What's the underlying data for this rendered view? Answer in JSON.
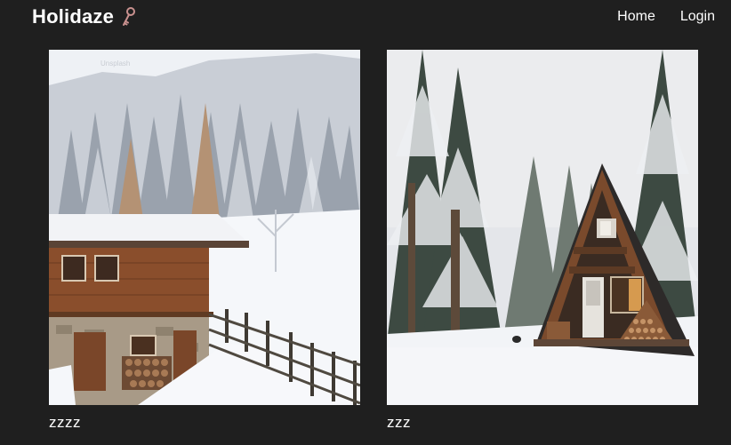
{
  "navbar": {
    "brand_text": "Holidaze",
    "brand_icon": "key-icon",
    "links": [
      {
        "label": "Home"
      },
      {
        "label": "Login"
      }
    ]
  },
  "venues": [
    {
      "title": "zzzz",
      "image": "snowy-wooden-chalet-photo",
      "watermark": "Unsplash"
    },
    {
      "title": "zzz",
      "image": "snowy-a-frame-cabin-photo"
    }
  ],
  "colors": {
    "background": "#1f1f1f",
    "text": "#ffffff",
    "brand_icon": "#c9918f"
  }
}
